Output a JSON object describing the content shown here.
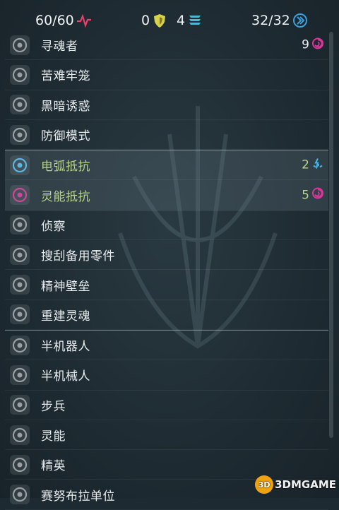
{
  "status_bar": {
    "health": "60/60",
    "shield": "0",
    "armor": "4",
    "energy": "32/32",
    "colors": {
      "health_icon": "#e8416a",
      "shield_icon": "#d9d14a",
      "armor_icon": "#4fb6d8",
      "energy_icon": "#3aa0e0"
    }
  },
  "traits": [
    {
      "label": "寻魂者",
      "icon": "soul-seeker-icon",
      "count": "9",
      "count_icon": "psionic-icon"
    },
    {
      "label": "苦难牢笼",
      "icon": "cage-icon"
    },
    {
      "label": "黑暗诱惑",
      "icon": "dark-lure-icon"
    },
    {
      "label": "防御模式",
      "icon": "defense-mode-icon"
    },
    {
      "label": "电弧抵抗",
      "icon": "arc-resist-icon",
      "count": "2",
      "count_icon": "arc-icon",
      "highlight": true
    },
    {
      "label": "灵能抵抗",
      "icon": "psionic-resist-icon",
      "count": "5",
      "count_icon": "psionic-icon",
      "highlight": true
    },
    {
      "label": "侦察",
      "icon": "eye-icon"
    },
    {
      "label": "搜刮备用零件",
      "icon": "repair-icon"
    },
    {
      "label": "精神壁垒",
      "icon": "mind-barrier-icon"
    },
    {
      "label": "重建灵魂",
      "icon": "rebuild-soul-icon"
    },
    {
      "label": "半机器人",
      "icon": "cyborg-icon"
    },
    {
      "label": "半机械人",
      "icon": "mech-human-icon"
    },
    {
      "label": "步兵",
      "icon": "infantry-icon"
    },
    {
      "label": "灵能",
      "icon": "psionic-icon"
    },
    {
      "label": "精英",
      "icon": "elite-icon"
    },
    {
      "label": "赛努布拉单位",
      "icon": "unit-icon"
    }
  ],
  "watermark": {
    "text": "3DMGAME",
    "logo_text": "3D"
  }
}
